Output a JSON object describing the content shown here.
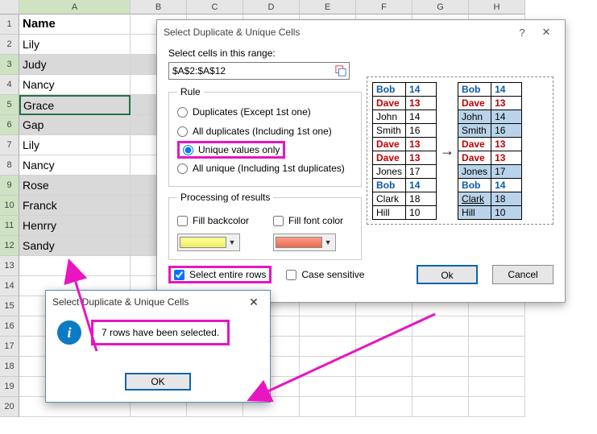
{
  "columns": [
    "A",
    "B",
    "C",
    "D",
    "E",
    "F",
    "G",
    "H"
  ],
  "rows": [
    {
      "n": 1,
      "val": "Name",
      "bold": true,
      "sel": false
    },
    {
      "n": 2,
      "val": "Lily",
      "sel": false
    },
    {
      "n": 3,
      "val": "Judy",
      "sel": true
    },
    {
      "n": 4,
      "val": "Nancy",
      "sel": false
    },
    {
      "n": 5,
      "val": "Grace",
      "sel": true,
      "active": true
    },
    {
      "n": 6,
      "val": "Gap",
      "sel": true
    },
    {
      "n": 7,
      "val": "Lily",
      "sel": false
    },
    {
      "n": 8,
      "val": "Nancy",
      "sel": false
    },
    {
      "n": 9,
      "val": "Rose",
      "sel": true
    },
    {
      "n": 10,
      "val": "Franck",
      "sel": true
    },
    {
      "n": 11,
      "val": "Henrry",
      "sel": true
    },
    {
      "n": 12,
      "val": "Sandy",
      "sel": true
    },
    {
      "n": 13,
      "val": "",
      "sel": false
    },
    {
      "n": 14,
      "val": "",
      "sel": false
    },
    {
      "n": 15,
      "val": "",
      "sel": false
    },
    {
      "n": 16,
      "val": "",
      "sel": false
    },
    {
      "n": 17,
      "val": "",
      "sel": false
    },
    {
      "n": 18,
      "val": "",
      "sel": false
    },
    {
      "n": 19,
      "val": "",
      "sel": false
    },
    {
      "n": 20,
      "val": "",
      "sel": false
    }
  ],
  "dialog": {
    "title": "Select Duplicate & Unique Cells",
    "help": "?",
    "close": "✕",
    "range_label": "Select cells in this range:",
    "range_value": "$A$2:$A$12",
    "rule_legend": "Rule",
    "opt1": "Duplicates (Except 1st one)",
    "opt2": "All duplicates (Including 1st one)",
    "opt3": "Unique values only",
    "opt4": "All unique (Including 1st duplicates)",
    "proc_legend": "Processing of results",
    "fill_back": "Fill backcolor",
    "fill_font": "Fill font color",
    "select_rows": "Select entire rows",
    "case_sens": "Case sensitive",
    "ok": "Ok",
    "cancel": "Cancel"
  },
  "preview": {
    "left": [
      {
        "name": "Bob",
        "v": "14",
        "cls": "c-blue"
      },
      {
        "name": "Dave",
        "v": "13",
        "cls": "c-red"
      },
      {
        "name": "John",
        "v": "14",
        "cls": ""
      },
      {
        "name": "Smith",
        "v": "16",
        "cls": ""
      },
      {
        "name": "Dave",
        "v": "13",
        "cls": "c-red"
      },
      {
        "name": "Dave",
        "v": "13",
        "cls": "c-red"
      },
      {
        "name": "Jones",
        "v": "17",
        "cls": ""
      },
      {
        "name": "Bob",
        "v": "14",
        "cls": "c-blue"
      },
      {
        "name": "Clark",
        "v": "18",
        "cls": ""
      },
      {
        "name": "Hill",
        "v": "10",
        "cls": ""
      }
    ],
    "right": [
      {
        "name": "Bob",
        "v": "14",
        "cls": "c-blue",
        "sel": false
      },
      {
        "name": "Dave",
        "v": "13",
        "cls": "c-red",
        "sel": false
      },
      {
        "name": "John",
        "v": "14",
        "cls": "",
        "sel": true
      },
      {
        "name": "Smith",
        "v": "16",
        "cls": "",
        "sel": true
      },
      {
        "name": "Dave",
        "v": "13",
        "cls": "c-red",
        "sel": false
      },
      {
        "name": "Dave",
        "v": "13",
        "cls": "c-red",
        "sel": false
      },
      {
        "name": "Jones",
        "v": "17",
        "cls": "",
        "sel": true
      },
      {
        "name": "Bob",
        "v": "14",
        "cls": "c-blue",
        "sel": false
      },
      {
        "name": "Clark",
        "v": "18",
        "cls": "",
        "sel": true,
        "ul": true
      },
      {
        "name": "Hill",
        "v": "10",
        "cls": "",
        "sel": true
      }
    ]
  },
  "msgbox": {
    "title": "Select Duplicate & Unique Cells",
    "close": "✕",
    "text": "7 rows have been selected.",
    "ok": "OK"
  }
}
